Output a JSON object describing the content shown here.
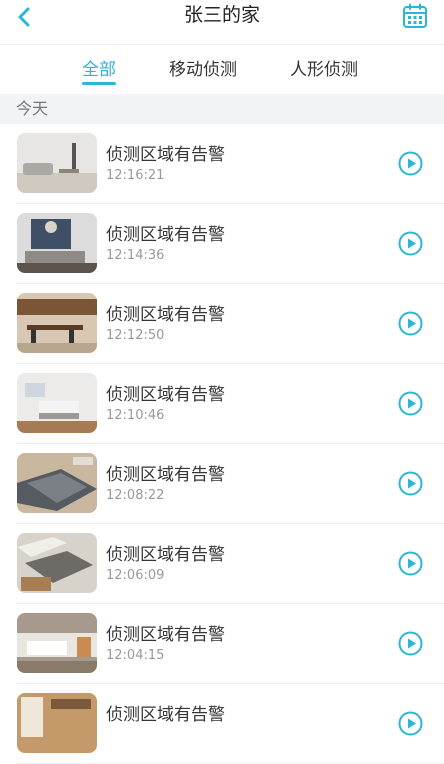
{
  "header": {
    "title": "张三的家",
    "back_icon": "chevron-left-icon",
    "calendar_icon": "calendar-icon",
    "accent": "#29b6d8"
  },
  "tabs": [
    {
      "label": "全部",
      "active": true
    },
    {
      "label": "移动侦测",
      "active": false
    },
    {
      "label": "人形侦测",
      "active": false
    }
  ],
  "section": {
    "label": "今天"
  },
  "events": [
    {
      "title": "侦测区域有告警",
      "time": "12:16:21"
    },
    {
      "title": "侦测区域有告警",
      "time": "12:14:36"
    },
    {
      "title": "侦测区域有告警",
      "time": "12:12:50"
    },
    {
      "title": "侦测区域有告警",
      "time": "12:10:46"
    },
    {
      "title": "侦测区域有告警",
      "time": "12:08:22"
    },
    {
      "title": "侦测区域有告警",
      "time": "12:06:09"
    },
    {
      "title": "侦测区域有告警",
      "time": "12:04:15"
    },
    {
      "title": "侦测区域有告警",
      "time": ""
    }
  ]
}
